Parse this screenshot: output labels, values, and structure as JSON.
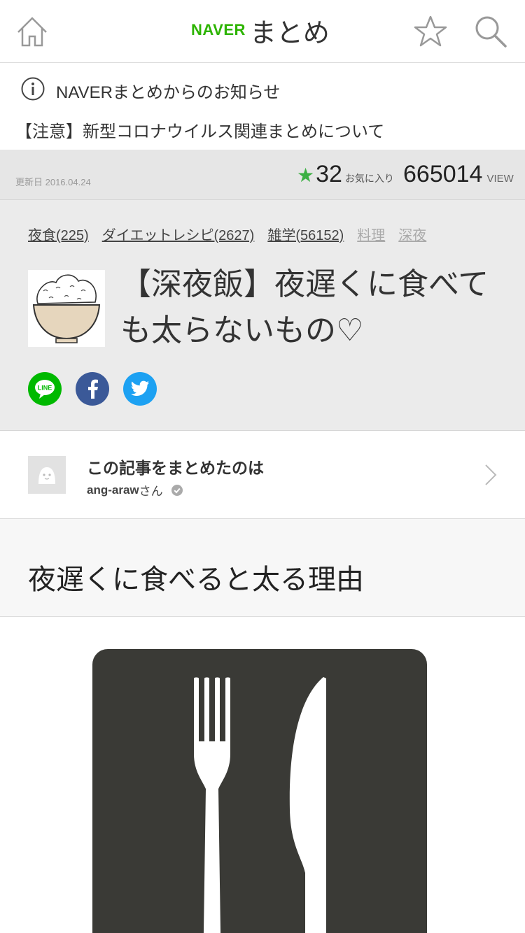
{
  "header": {
    "logo_naver": "NAVER",
    "logo_matome": "まとめ",
    "icons": [
      "home-icon",
      "star-icon",
      "search-icon"
    ]
  },
  "notice": {
    "title": "NAVERまとめからのお知らせ",
    "link": "【注意】新型コロナウイルス関連まとめについて"
  },
  "stats": {
    "updated": "更新日 2016.04.24",
    "fav_star": "★",
    "fav_count": "32",
    "fav_label": "お気に入り",
    "view_count": "665014",
    "view_label": "VIEW"
  },
  "article": {
    "tags": [
      {
        "label": "夜食(225)"
      },
      {
        "label": "ダイエットレシピ(2627)"
      },
      {
        "label": "雑学(56152)"
      },
      {
        "label": "料理"
      },
      {
        "label": "深夜"
      }
    ],
    "title": "【深夜飯】夜遅くに食べても太らないもの♡",
    "share": {
      "line_label": "LINE"
    }
  },
  "author": {
    "heading": "この記事をまとめたのは",
    "name": "ang-araw",
    "suffix": "さん"
  },
  "section": {
    "title": "夜遅くに食べると太る理由"
  },
  "colors": {
    "naver_green": "#2db400",
    "fav_star": "#3cb043",
    "line": "#00b900",
    "facebook": "#3b5998",
    "twitter": "#1da1f2",
    "cutlery_bg": "#3a3a36"
  }
}
